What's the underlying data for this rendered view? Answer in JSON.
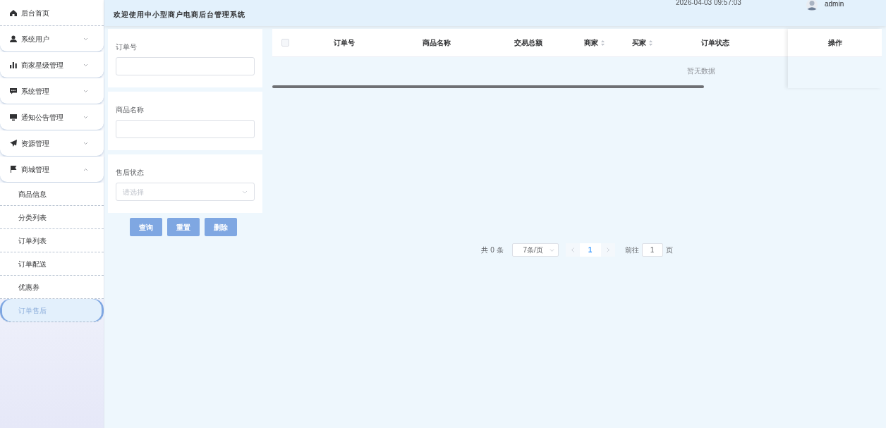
{
  "sidebar": {
    "items": [
      {
        "label": "后台首页",
        "has_children": false
      },
      {
        "label": "系统用户",
        "expanded": false,
        "has_children": true
      },
      {
        "label": "商家星级管理",
        "expanded": false,
        "has_children": true
      },
      {
        "label": "系统管理",
        "expanded": false,
        "has_children": true
      },
      {
        "label": "通知公告管理",
        "expanded": false,
        "has_children": true
      },
      {
        "label": "资源管理",
        "expanded": false,
        "has_children": true
      },
      {
        "label": "商城管理",
        "expanded": true,
        "has_children": true,
        "children": [
          {
            "label": "商品信息",
            "selected": false
          },
          {
            "label": "分类列表",
            "selected": false
          },
          {
            "label": "订单列表",
            "selected": false
          },
          {
            "label": "订单配送",
            "selected": false
          },
          {
            "label": "优惠券",
            "selected": false
          },
          {
            "label": "订单售后",
            "selected": true
          }
        ]
      }
    ]
  },
  "header": {
    "title": "欢迎使用中小型商户电商后台管理系统",
    "datetime": "2026-04-03 09:57:03",
    "user": "admin"
  },
  "search_form": {
    "fields": [
      {
        "kind": "text",
        "label": "订单号"
      },
      {
        "kind": "text",
        "label": "商品名称"
      },
      {
        "kind": "select",
        "label": "售后状态",
        "placeholder": "请选择"
      }
    ],
    "buttons": [
      "查询",
      "重置",
      "删除"
    ]
  },
  "table": {
    "columns": [
      {
        "label": "订单号",
        "sortable": false
      },
      {
        "label": "商品名称",
        "sortable": false
      },
      {
        "label": "交易总额",
        "sortable": false
      },
      {
        "label": "商家",
        "sortable": true
      },
      {
        "label": "买家",
        "sortable": true
      },
      {
        "label": "订单状态",
        "sortable": false
      }
    ],
    "fixed_column": "操作",
    "empty_text": "暂无数据",
    "all_checked": false
  },
  "pagination": {
    "total": "共 0 条",
    "page_size": "7条/页",
    "current_page": "1",
    "goto_label": "前往",
    "goto_value": "1",
    "goto_suffix": "页"
  }
}
